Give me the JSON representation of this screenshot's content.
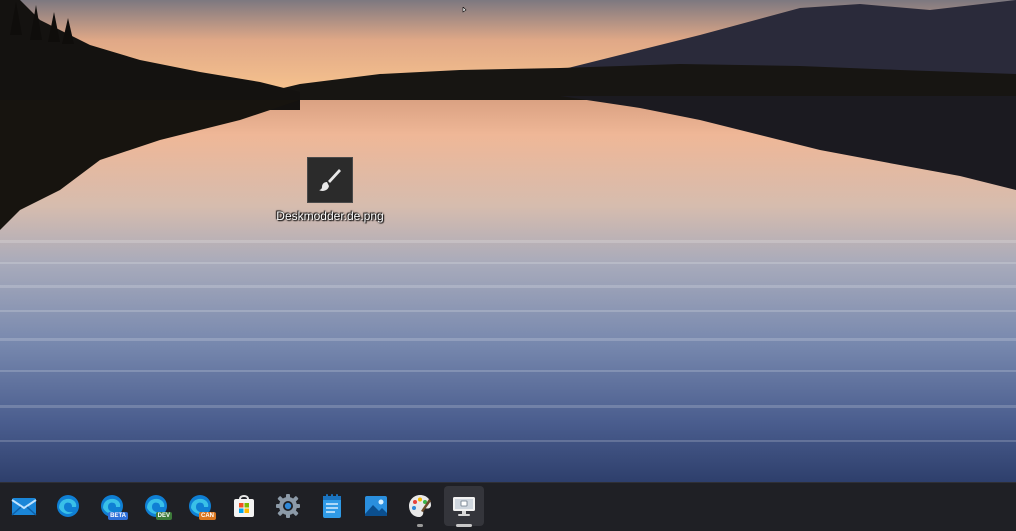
{
  "desktop": {
    "icons": [
      {
        "label": "Deskmodder.de.png",
        "icon": "paintbrush-icon"
      }
    ]
  },
  "taskbar": {
    "apps": [
      {
        "name": "Mail",
        "icon": "mail-icon",
        "badge": ""
      },
      {
        "name": "Microsoft Edge",
        "icon": "edge-icon",
        "badge": ""
      },
      {
        "name": "Microsoft Edge Beta",
        "icon": "edge-beta-icon",
        "badge": "BETA",
        "badge_color": "#2f6fd8"
      },
      {
        "name": "Microsoft Edge Dev",
        "icon": "edge-dev-icon",
        "badge": "DEV",
        "badge_color": "#3d7a3a"
      },
      {
        "name": "Microsoft Edge Canary",
        "icon": "edge-canary-icon",
        "badge": "CAN",
        "badge_color": "#d9761f"
      },
      {
        "name": "Microsoft Store",
        "icon": "store-icon",
        "badge": ""
      },
      {
        "name": "Settings",
        "icon": "gear-icon",
        "badge": ""
      },
      {
        "name": "Notepad",
        "icon": "notepad-icon",
        "badge": ""
      },
      {
        "name": "Photos",
        "icon": "photos-icon",
        "badge": ""
      },
      {
        "name": "Paint",
        "icon": "paint-icon",
        "badge": "",
        "running": true
      },
      {
        "name": "Remote Desktop",
        "icon": "monitor-icon",
        "badge": "",
        "running": true,
        "active": true
      }
    ]
  },
  "colors": {
    "taskbar_bg": "#1f2025",
    "edge_blue": "#0f7fd4",
    "edge_green": "#39b54a"
  }
}
